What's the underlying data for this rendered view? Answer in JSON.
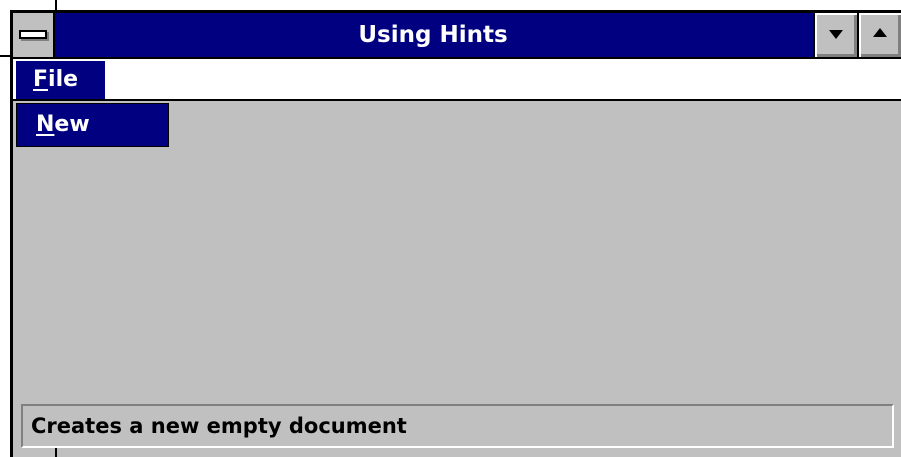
{
  "window": {
    "title": "Using Hints",
    "system_menu_icon": "system-menu-icon",
    "minimize_icon": "triangle-down-icon",
    "maximize_icon": "triangle-up-icon"
  },
  "menubar": {
    "file_mnemonic": "F",
    "file_rest": "ile"
  },
  "file_menu": {
    "new_mnemonic": "N",
    "new_rest": "ew"
  },
  "statusbar": {
    "hint": "Creates a new empty document"
  },
  "colors": {
    "title_bar": "#000080",
    "face": "#c0c0c0",
    "highlight": "#000080",
    "text_light": "#ffffff"
  }
}
